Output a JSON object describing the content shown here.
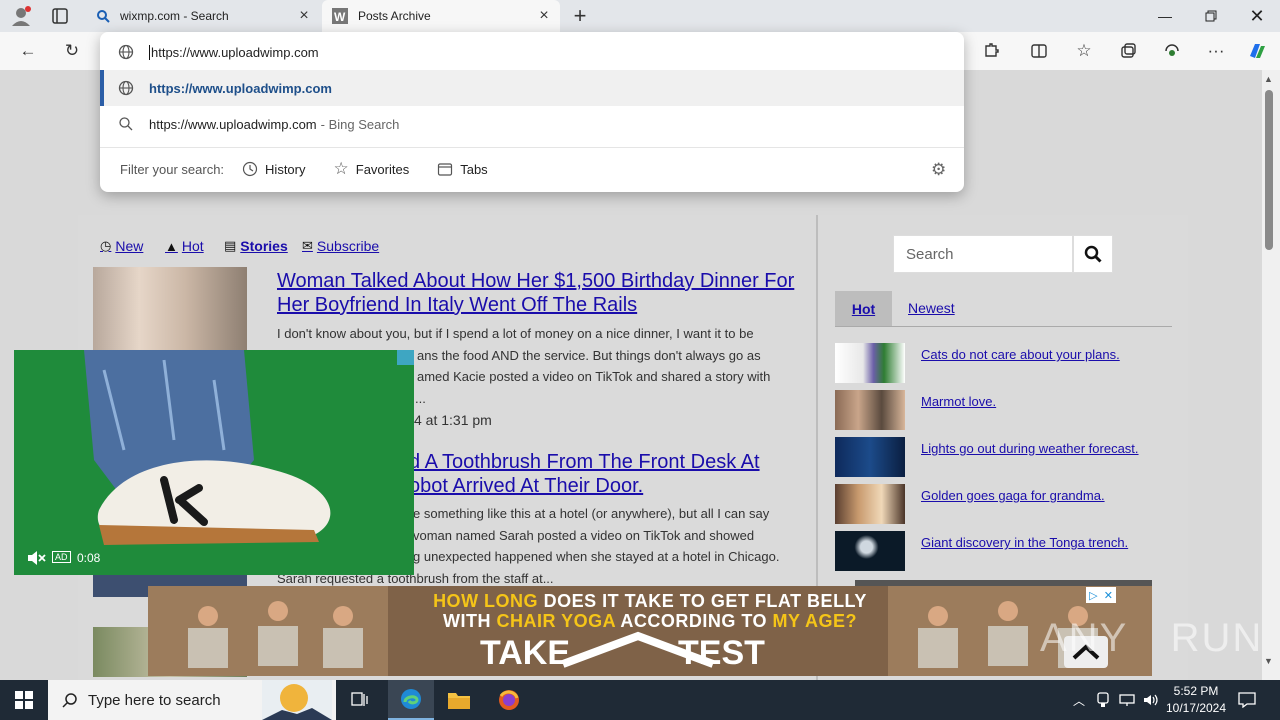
{
  "browser": {
    "tabs": [
      {
        "label": "wixmp.com - Search"
      },
      {
        "label": "Posts Archive"
      }
    ],
    "address": "https://www.uploadwimp.com"
  },
  "omnibox": {
    "suggestion_url": "https://www.uploadwimp.com",
    "search_query": "https://www.uploadwimp.com",
    "search_suffix": "- Bing Search",
    "filter_label": "Filter your search:",
    "filters": [
      "History",
      "Favorites",
      "Tabs"
    ]
  },
  "nav": {
    "new": "New",
    "hot": "Hot",
    "stories": "Stories",
    "subscribe": "Subscribe"
  },
  "articles": [
    {
      "title": "Woman Talked About How Her $1,500 Birthday Dinner For Her Boyfriend In Italy Went Off The Rails",
      "excerpt": [
        "I don't know about you, but if I spend a lot of money on a nice dinner, I want it to be",
        "ans the food AND the service. But things don't always go as",
        "amed Kacie posted a video on TikTok and shared a story with",
        "..."
      ],
      "date": "4 at 1:31 pm"
    },
    {
      "title_lines": [
        "d A Toothbrush From The Front Desk At",
        "obot Arrived At Their Door."
      ],
      "excerpt": [
        "e something like this at a hotel (or anywhere), but all I can say",
        "voman named Sarah posted a video on TikTok and showed",
        "g unexpected happened when she stayed at a hotel in Chicago.",
        "Sarah requested a toothbrush from the staff at..."
      ]
    }
  ],
  "sidebar": {
    "search_placeholder": "Search",
    "tab_hot": "Hot",
    "tab_newest": "Newest",
    "items": [
      {
        "label": "Cats do not care about your plans."
      },
      {
        "label": "Marmot love."
      },
      {
        "label": "Lights go out during weather forecast."
      },
      {
        "label": "Golden goes gaga for grandma."
      },
      {
        "label": "Giant discovery in the Tonga trench."
      }
    ]
  },
  "video_ad": {
    "badge": "AD",
    "time": "0:08"
  },
  "banner_ad": {
    "line1_parts": [
      "HOW LONG",
      " DOES IT TAKE TO GET FLAT BELLY"
    ],
    "line2_parts": [
      "WITH ",
      "CHAIR YOGA",
      " ACCORDING TO ",
      "MY AGE?"
    ],
    "cta_left": "TAKE",
    "cta_right": "TEST",
    "highlight_color": "#f5c518"
  },
  "watermark": "ANY RUN",
  "taskbar": {
    "search_placeholder": "Type here to search",
    "time": "5:52 PM",
    "date": "10/17/2024"
  }
}
